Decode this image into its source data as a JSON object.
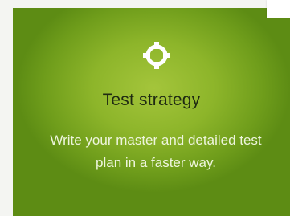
{
  "card": {
    "icon": "crosshair-target-icon",
    "title": "Test strategy",
    "description": "Write your master and detailed test plan in a faster way."
  },
  "colors": {
    "card_green": "#8db52a",
    "title_text": "#1f2a12",
    "body_text": "#eef5dd"
  }
}
